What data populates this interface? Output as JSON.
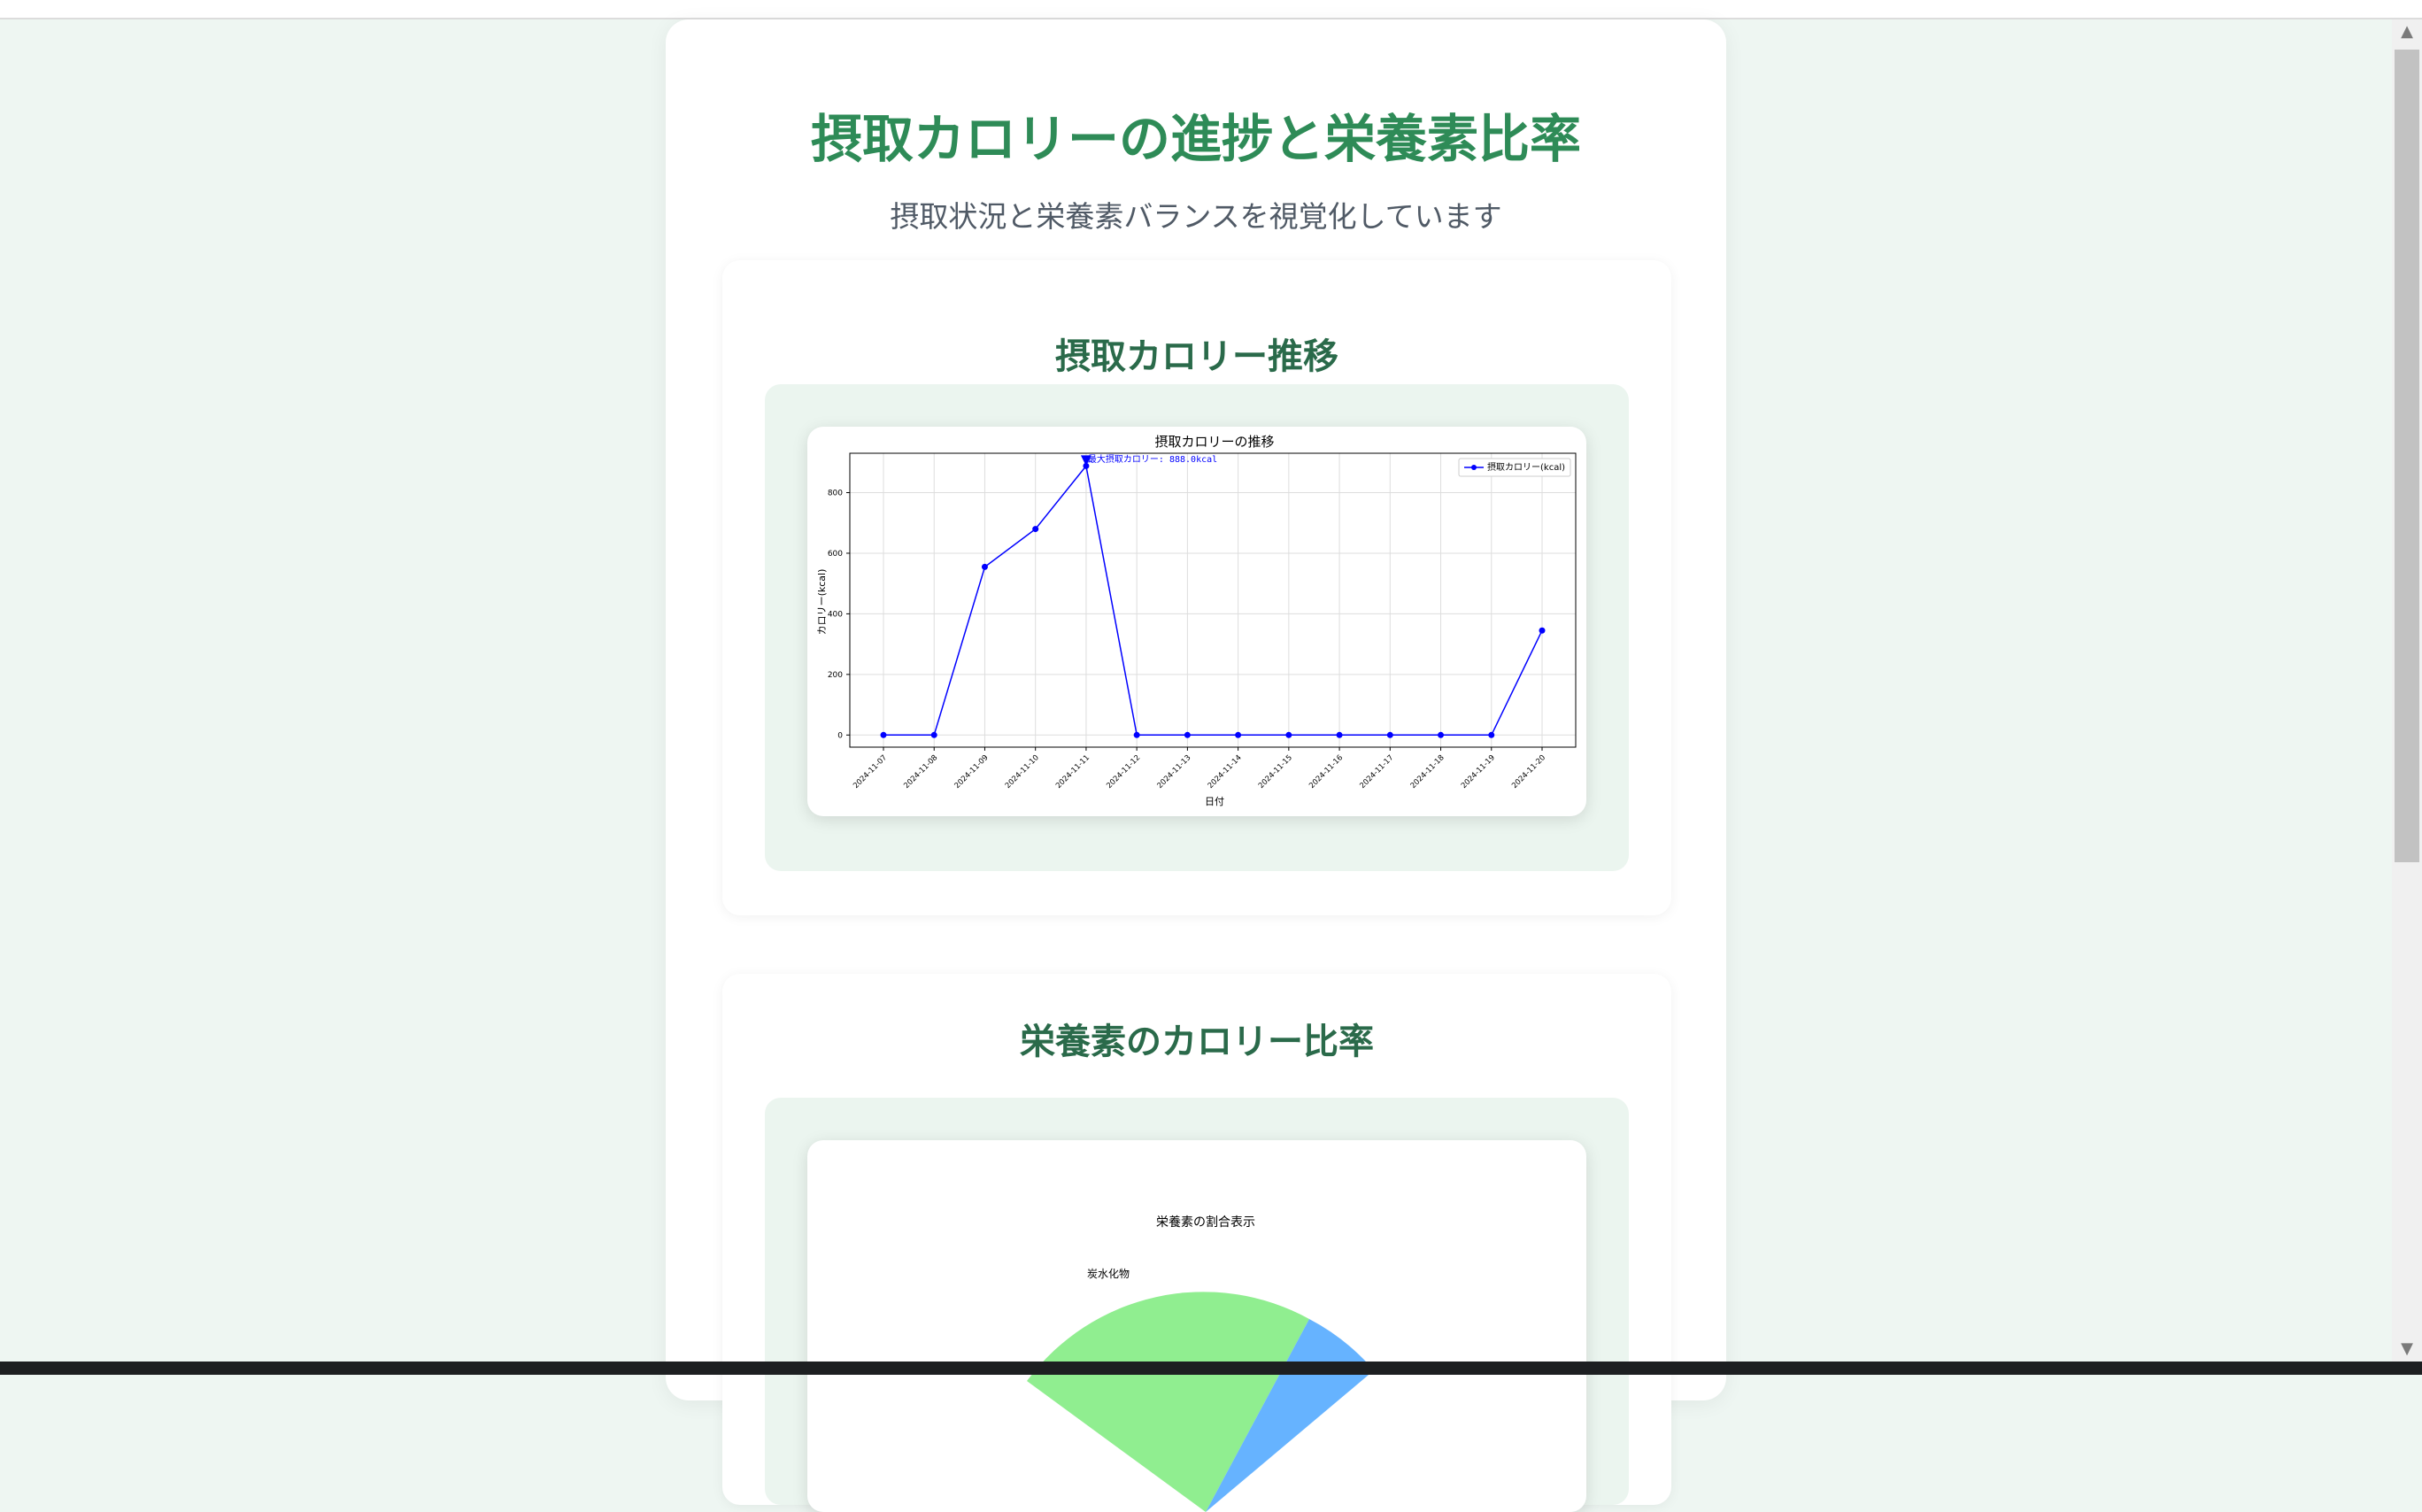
{
  "page": {
    "title": "摂取カロリーの進捗と栄養素比率",
    "subtitle": "摂取状況と栄養素バランスを視覚化しています"
  },
  "sections": [
    {
      "title": "摂取カロリー推移"
    },
    {
      "title": "栄養素のカロリー比率"
    }
  ],
  "colors": {
    "accent": "#2e8b57",
    "line": "#0000ff",
    "pie_carbs": "#90ee90",
    "pie_blue": "#66b3ff"
  },
  "chart_data": [
    {
      "type": "line",
      "title": "摂取カロリーの推移",
      "xlabel": "日付",
      "ylabel": "カロリー(kcal)",
      "x": [
        "2024-11-07",
        "2024-11-08",
        "2024-11-09",
        "2024-11-10",
        "2024-11-11",
        "2024-11-12",
        "2024-11-13",
        "2024-11-14",
        "2024-11-15",
        "2024-11-16",
        "2024-11-17",
        "2024-11-18",
        "2024-11-19",
        "2024-11-20"
      ],
      "series": [
        {
          "name": "摂取カロリー(kcal)",
          "values": [
            0,
            0,
            555,
            680,
            888,
            0,
            0,
            0,
            0,
            0,
            0,
            0,
            0,
            345
          ]
        }
      ],
      "yticks": [
        "0",
        "200",
        "400",
        "600",
        "800"
      ],
      "ylim": [
        -40,
        930
      ],
      "grid": true,
      "legend": "top-right",
      "annotation": "最大摂取カロリー: 888.0kcal"
    },
    {
      "type": "pie",
      "title": "栄養素の割合表示",
      "labels": [
        "炭水化物"
      ]
    }
  ]
}
